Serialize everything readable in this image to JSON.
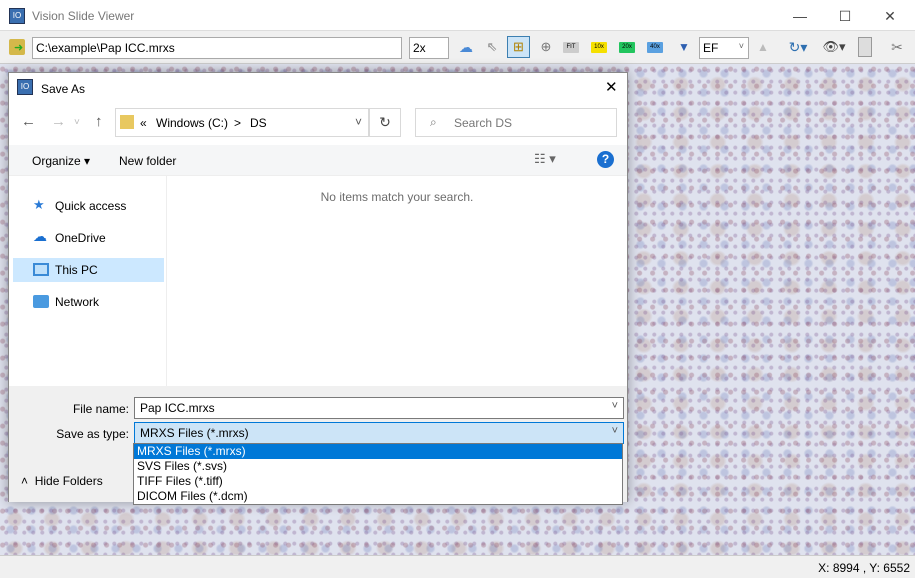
{
  "app": {
    "title": "Vision Slide Viewer"
  },
  "toolbar": {
    "path": "C:\\example\\Pap ICC.mrxs",
    "zoom": "2x",
    "fit": "FIT",
    "z10": "10x",
    "z20": "20x",
    "z40": "40x",
    "focus": "EF"
  },
  "dialog": {
    "title": "Save As",
    "breadcrumb": {
      "prefix": "«",
      "drive": "Windows (C:)",
      "sep": ">",
      "folder": "DS"
    },
    "search_placeholder": "Search DS",
    "organize": "Organize ▾",
    "new_folder": "New folder",
    "sidebar": [
      {
        "label": "Quick access",
        "icon": "star-icon"
      },
      {
        "label": "OneDrive",
        "icon": "cloud-icon"
      },
      {
        "label": "This PC",
        "icon": "monitor-icon",
        "selected": true
      },
      {
        "label": "Network",
        "icon": "network-icon"
      }
    ],
    "empty_message": "No items match your search.",
    "file_name_label": "File name:",
    "file_name": "Pap ICC.mrxs",
    "type_label": "Save as type:",
    "type_value": "MRXS Files (*.mrxs)",
    "type_options": [
      "MRXS Files (*.mrxs)",
      "SVS Files (*.svs)",
      "TIFF Files (*.tiff)",
      "DICOM Files (*.dcm)"
    ],
    "hide_folders": "Hide Folders"
  },
  "status": {
    "coords": "X: 8994 , Y: 6552"
  }
}
